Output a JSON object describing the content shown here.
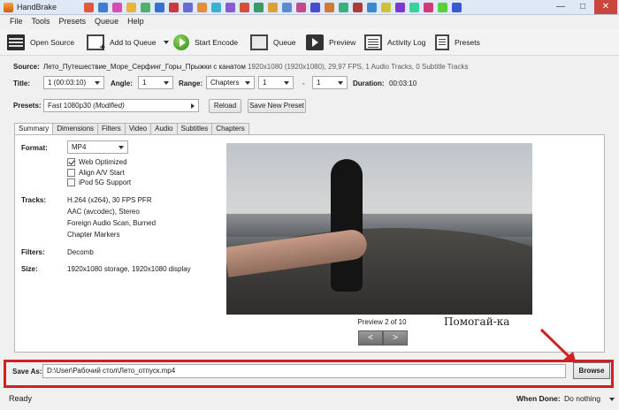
{
  "window": {
    "title": "HandBrake",
    "minimize": "—",
    "maximize": "□",
    "close": "✕"
  },
  "taskbar_icon_colors": [
    "#e05a3a",
    "#3a7fd0",
    "#d64bb5",
    "#e7b53a",
    "#4fb06a",
    "#3a6fd0",
    "#cc3a3a",
    "#6a6ad6",
    "#e0903a",
    "#3ab0d0",
    "#8a5ad0",
    "#d0503a",
    "#3a9a6a",
    "#d6a03a",
    "#5a8ad0",
    "#c04a8a",
    "#4a4ad0",
    "#d07a3a",
    "#3ab07a",
    "#b03a3a",
    "#3a8ad0",
    "#d0c03a",
    "#7a3ad0",
    "#3ad0a0",
    "#d03a7a",
    "#5ad03a",
    "#3a5ad0"
  ],
  "menu": [
    "File",
    "Tools",
    "Presets",
    "Queue",
    "Help"
  ],
  "toolbar": {
    "open_source": "Open Source",
    "add_to_queue": "Add to Queue",
    "start_encode": "Start Encode",
    "queue": "Queue",
    "preview": "Preview",
    "activity_log": "Activity Log",
    "presets": "Presets"
  },
  "source": {
    "label": "Source:",
    "name": "Лето_Путешествие_Море_Серфинг_Горы_Прыжки с канатом",
    "info": "1920x1080 (1920x1080), 29,97 FPS, 1 Audio Tracks, 0 Subtitle Tracks"
  },
  "title_row": {
    "title_label": "Title:",
    "title_value": "1 (00:03:10)",
    "angle_label": "Angle:",
    "angle_value": "1",
    "range_label": "Range:",
    "range_type": "Chapters",
    "range_start": "1",
    "range_sep": "-",
    "range_end": "1",
    "duration_label": "Duration:",
    "duration_value": "00:03:10"
  },
  "presets_row": {
    "label": "Presets:",
    "preset_name": "Fast 1080p30",
    "preset_modified": "(Modified)",
    "reload": "Reload",
    "save_new": "Save New Preset"
  },
  "tabs": [
    "Summary",
    "Dimensions",
    "Filters",
    "Video",
    "Audio",
    "Subtitles",
    "Chapters"
  ],
  "summary": {
    "format_label": "Format:",
    "format_value": "MP4",
    "options": [
      {
        "label": "Web Optimized",
        "checked": true
      },
      {
        "label": "Align A/V Start",
        "checked": false
      },
      {
        "label": "iPod 5G Support",
        "checked": false
      }
    ],
    "tracks_label": "Tracks:",
    "tracks": [
      "H.264 (x264), 30 FPS PFR",
      "AAC (avcodec), Stereo",
      "Foreign Audio Scan, Burned",
      "Chapter Markers"
    ],
    "filters_label": "Filters:",
    "filters_value": "Decomb",
    "size_label": "Size:",
    "size_value": "1920x1080 storage, 1920x1080 display"
  },
  "preview": {
    "caption": "Preview 2 of 10",
    "watermark": "Помогай-ка",
    "prev": "<",
    "next": ">"
  },
  "save_as": {
    "label": "Save As:",
    "path": "D:\\User\\Рабочий стол\\Лето_отпуск.mp4",
    "browse": "Browse"
  },
  "status": {
    "text": "Ready",
    "when_done_label": "When Done:",
    "when_done_value": "Do nothing"
  },
  "colors": {
    "highlight": "#d11f24"
  }
}
